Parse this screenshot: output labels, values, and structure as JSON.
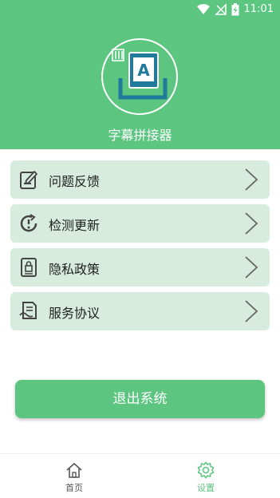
{
  "status_bar": {
    "time": "11:01"
  },
  "app": {
    "name": "字幕拼接器"
  },
  "menu": [
    {
      "label": "问题反馈",
      "icon": "feedback-icon"
    },
    {
      "label": "检测更新",
      "icon": "update-icon"
    },
    {
      "label": "隐私政策",
      "icon": "privacy-icon"
    },
    {
      "label": "服务协议",
      "icon": "agreement-icon"
    }
  ],
  "logout": {
    "label": "退出系统"
  },
  "tabs": [
    {
      "label": "首页",
      "icon": "home-icon",
      "active": false
    },
    {
      "label": "设置",
      "icon": "settings-icon",
      "active": true
    }
  ],
  "colors": {
    "accent": "#5cc680",
    "menu_bg": "#d7ecdf",
    "active_tab": "#5cc680",
    "inactive_tab": "#555555"
  }
}
